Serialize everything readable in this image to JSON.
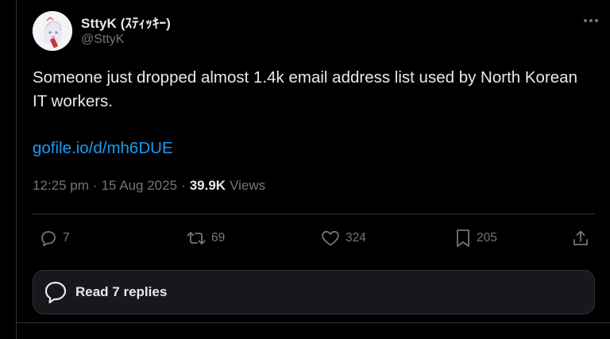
{
  "author": {
    "display_name": "SttyK (ｽﾃｨｯｷｰ)",
    "handle": "@SttyK"
  },
  "tweet": {
    "text": "Someone just dropped almost 1.4k email address list used by North Korean IT workers.",
    "link": "gofile.io/d/mh6DUE",
    "time": "12:25 pm",
    "date": "15 Aug 2025",
    "views_count": "39.9K",
    "views_label": "Views",
    "separator": "·"
  },
  "actions": {
    "replies": "7",
    "reposts": "69",
    "likes": "324",
    "bookmarks": "205"
  },
  "read_replies_label": "Read 7 replies",
  "colors": {
    "background": "#000000",
    "text": "#e7e9ea",
    "muted": "#71767b",
    "link": "#1d9bf0",
    "border": "#2f3336"
  }
}
